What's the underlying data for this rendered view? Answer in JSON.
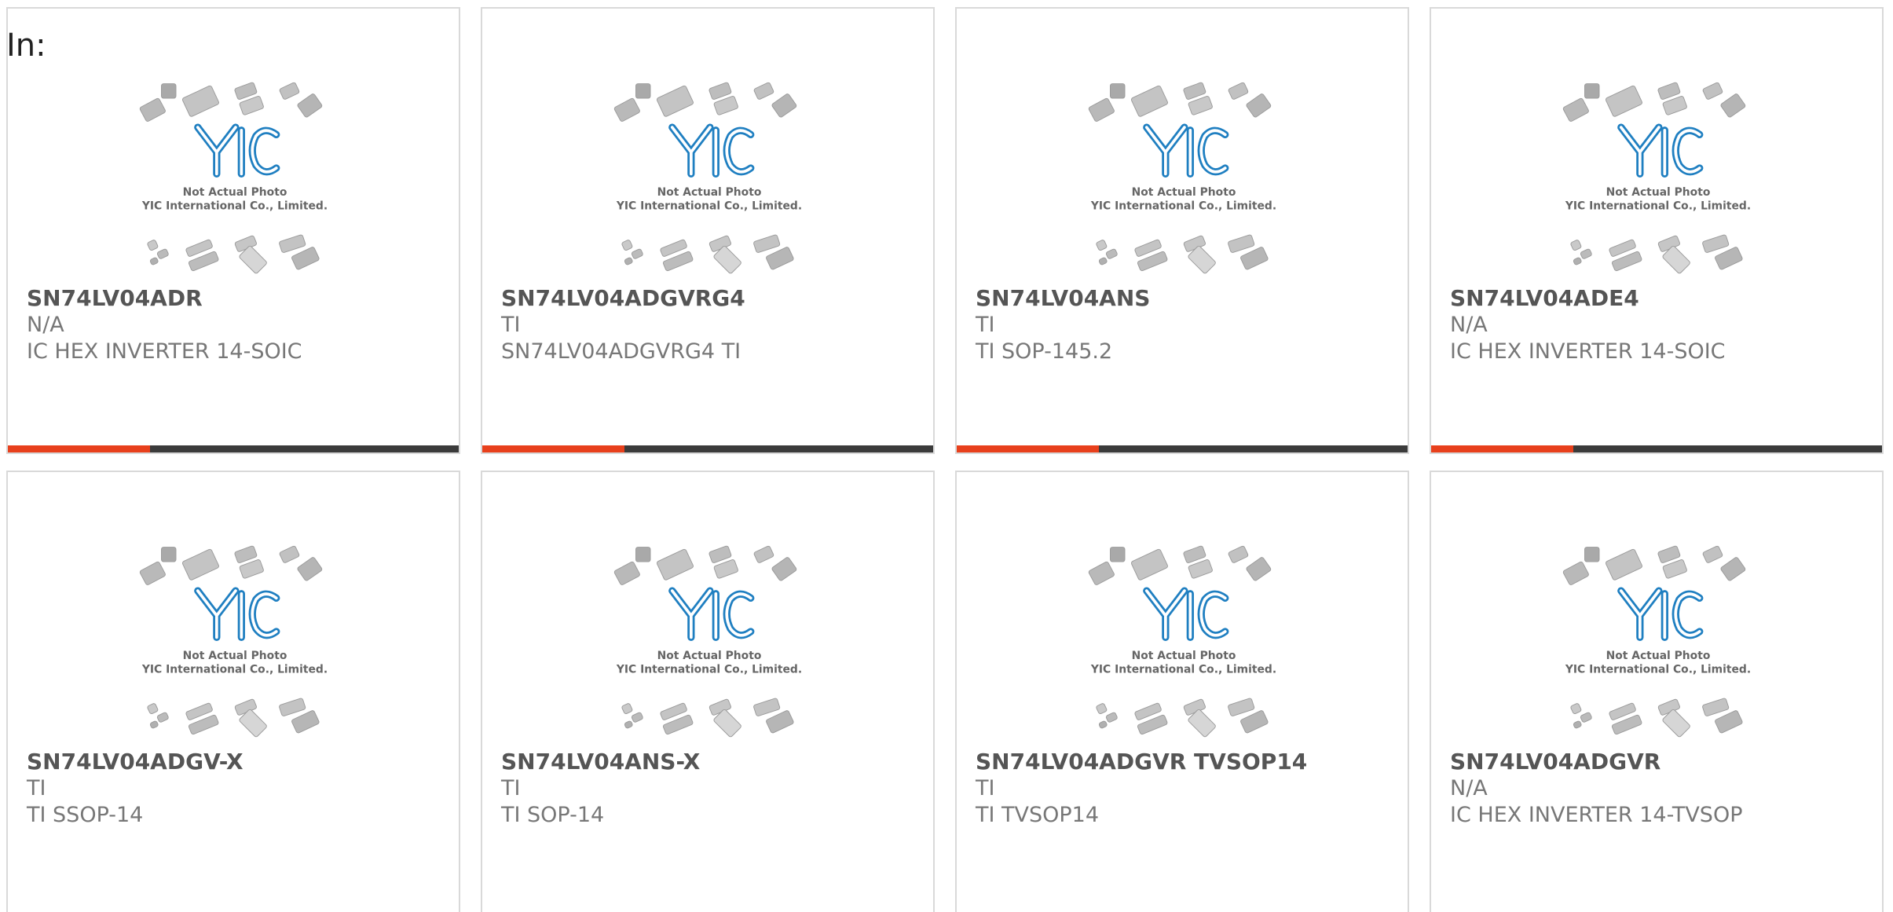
{
  "header": {
    "in_label": "In:"
  },
  "placeholder": {
    "caption_line1": "Not Actual Photo",
    "caption_line2": "YIC International Co., Limited.",
    "logo_text": "YIC"
  },
  "colors": {
    "accent": "#e8401c",
    "bar_dark": "#3b3b3b",
    "border": "#d9d9d9",
    "title": "#555555",
    "text": "#777777",
    "logo_blue": "#1f7fc1"
  },
  "products": [
    {
      "part_number": "SN74LV04ADR",
      "manufacturer": "N/A",
      "description": "IC HEX INVERTER 14-SOIC"
    },
    {
      "part_number": "SN74LV04ADGVRG4",
      "manufacturer": "TI",
      "description": "SN74LV04ADGVRG4 TI"
    },
    {
      "part_number": "SN74LV04ANS",
      "manufacturer": "TI",
      "description": "TI SOP-145.2"
    },
    {
      "part_number": "SN74LV04ADE4",
      "manufacturer": "N/A",
      "description": "IC HEX INVERTER 14-SOIC"
    },
    {
      "part_number": "SN74LV04ADGV-X",
      "manufacturer": "TI",
      "description": "TI SSOP-14"
    },
    {
      "part_number": "SN74LV04ANS-X",
      "manufacturer": "TI",
      "description": "TI SOP-14"
    },
    {
      "part_number": "SN74LV04ADGVR TVSOP14",
      "manufacturer": "TI",
      "description": "TI TVSOP14"
    },
    {
      "part_number": "SN74LV04ADGVR",
      "manufacturer": "N/A",
      "description": "IC HEX INVERTER 14-TVSOP"
    }
  ]
}
